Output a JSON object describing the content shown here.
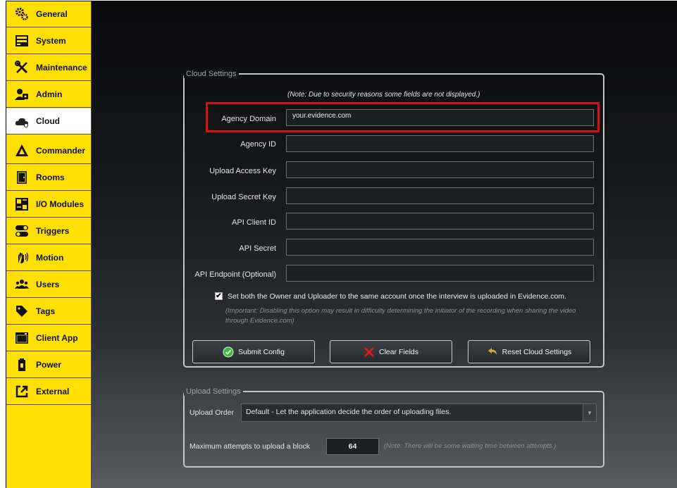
{
  "sidebar": {
    "items": [
      {
        "label": "General",
        "icon": "gears-icon"
      },
      {
        "label": "System",
        "icon": "server-icon"
      },
      {
        "label": "Maintenance",
        "icon": "tools-icon"
      },
      {
        "label": "Admin",
        "icon": "admin-users-icon"
      },
      {
        "label": "Cloud",
        "icon": "cloud-icon",
        "active": true
      },
      {
        "label": "Commander",
        "icon": "commander-icon"
      },
      {
        "label": "Rooms",
        "icon": "door-icon"
      },
      {
        "label": "I/O Modules",
        "icon": "io-module-icon"
      },
      {
        "label": "Triggers",
        "icon": "toggle-icon"
      },
      {
        "label": "Motion",
        "icon": "motion-wave-icon"
      },
      {
        "label": "Users",
        "icon": "users-icon"
      },
      {
        "label": "Tags",
        "icon": "tag-icon"
      },
      {
        "label": "Client App",
        "icon": "window-icon"
      },
      {
        "label": "Power",
        "icon": "battery-icon"
      },
      {
        "label": "External",
        "icon": "external-link-icon"
      }
    ]
  },
  "cloud_settings": {
    "legend": "Cloud Settings",
    "note": "(Note: Due to security reasons some fields are not displayed.)",
    "fields": [
      {
        "label": "Agency Domain",
        "value": "your.evidence.com"
      },
      {
        "label": "Agency ID",
        "value": ""
      },
      {
        "label": "Upload Access Key",
        "value": ""
      },
      {
        "label": "Upload Secret Key",
        "value": ""
      },
      {
        "label": "API Client ID",
        "value": ""
      },
      {
        "label": "API Secret",
        "value": ""
      },
      {
        "label": "API Endpoint (Optional)",
        "value": ""
      }
    ],
    "checkbox_label": "Set both the Owner and Uploader to the same account once the interview is uploaded in Evidence.com.",
    "checkbox_checked": true,
    "important_note": "(Important: Disabling this option may result in difficulty determining the initiator of the recording when sharing the video through Evidence.com)",
    "buttons": {
      "submit": "Submit Config",
      "clear": "Clear Fields",
      "reset": "Reset Cloud Settings"
    }
  },
  "upload_settings": {
    "legend": "Upload Settings",
    "order_label": "Upload Order",
    "order_value": "Default - Let the application decide the order of uploading files.",
    "attempts_label": "Maximum attempts to upload a block",
    "attempts_value": "64",
    "attempts_note": "(Note: There will be some waiting time between attempts.)"
  },
  "colors": {
    "sidebar_bg": "#ffe000",
    "active_item_bg": "#ffffff",
    "highlight_border": "#d41111",
    "submit_icon": "#3db93d",
    "clear_icon": "#d62020",
    "reset_icon": "#e8a23a"
  }
}
